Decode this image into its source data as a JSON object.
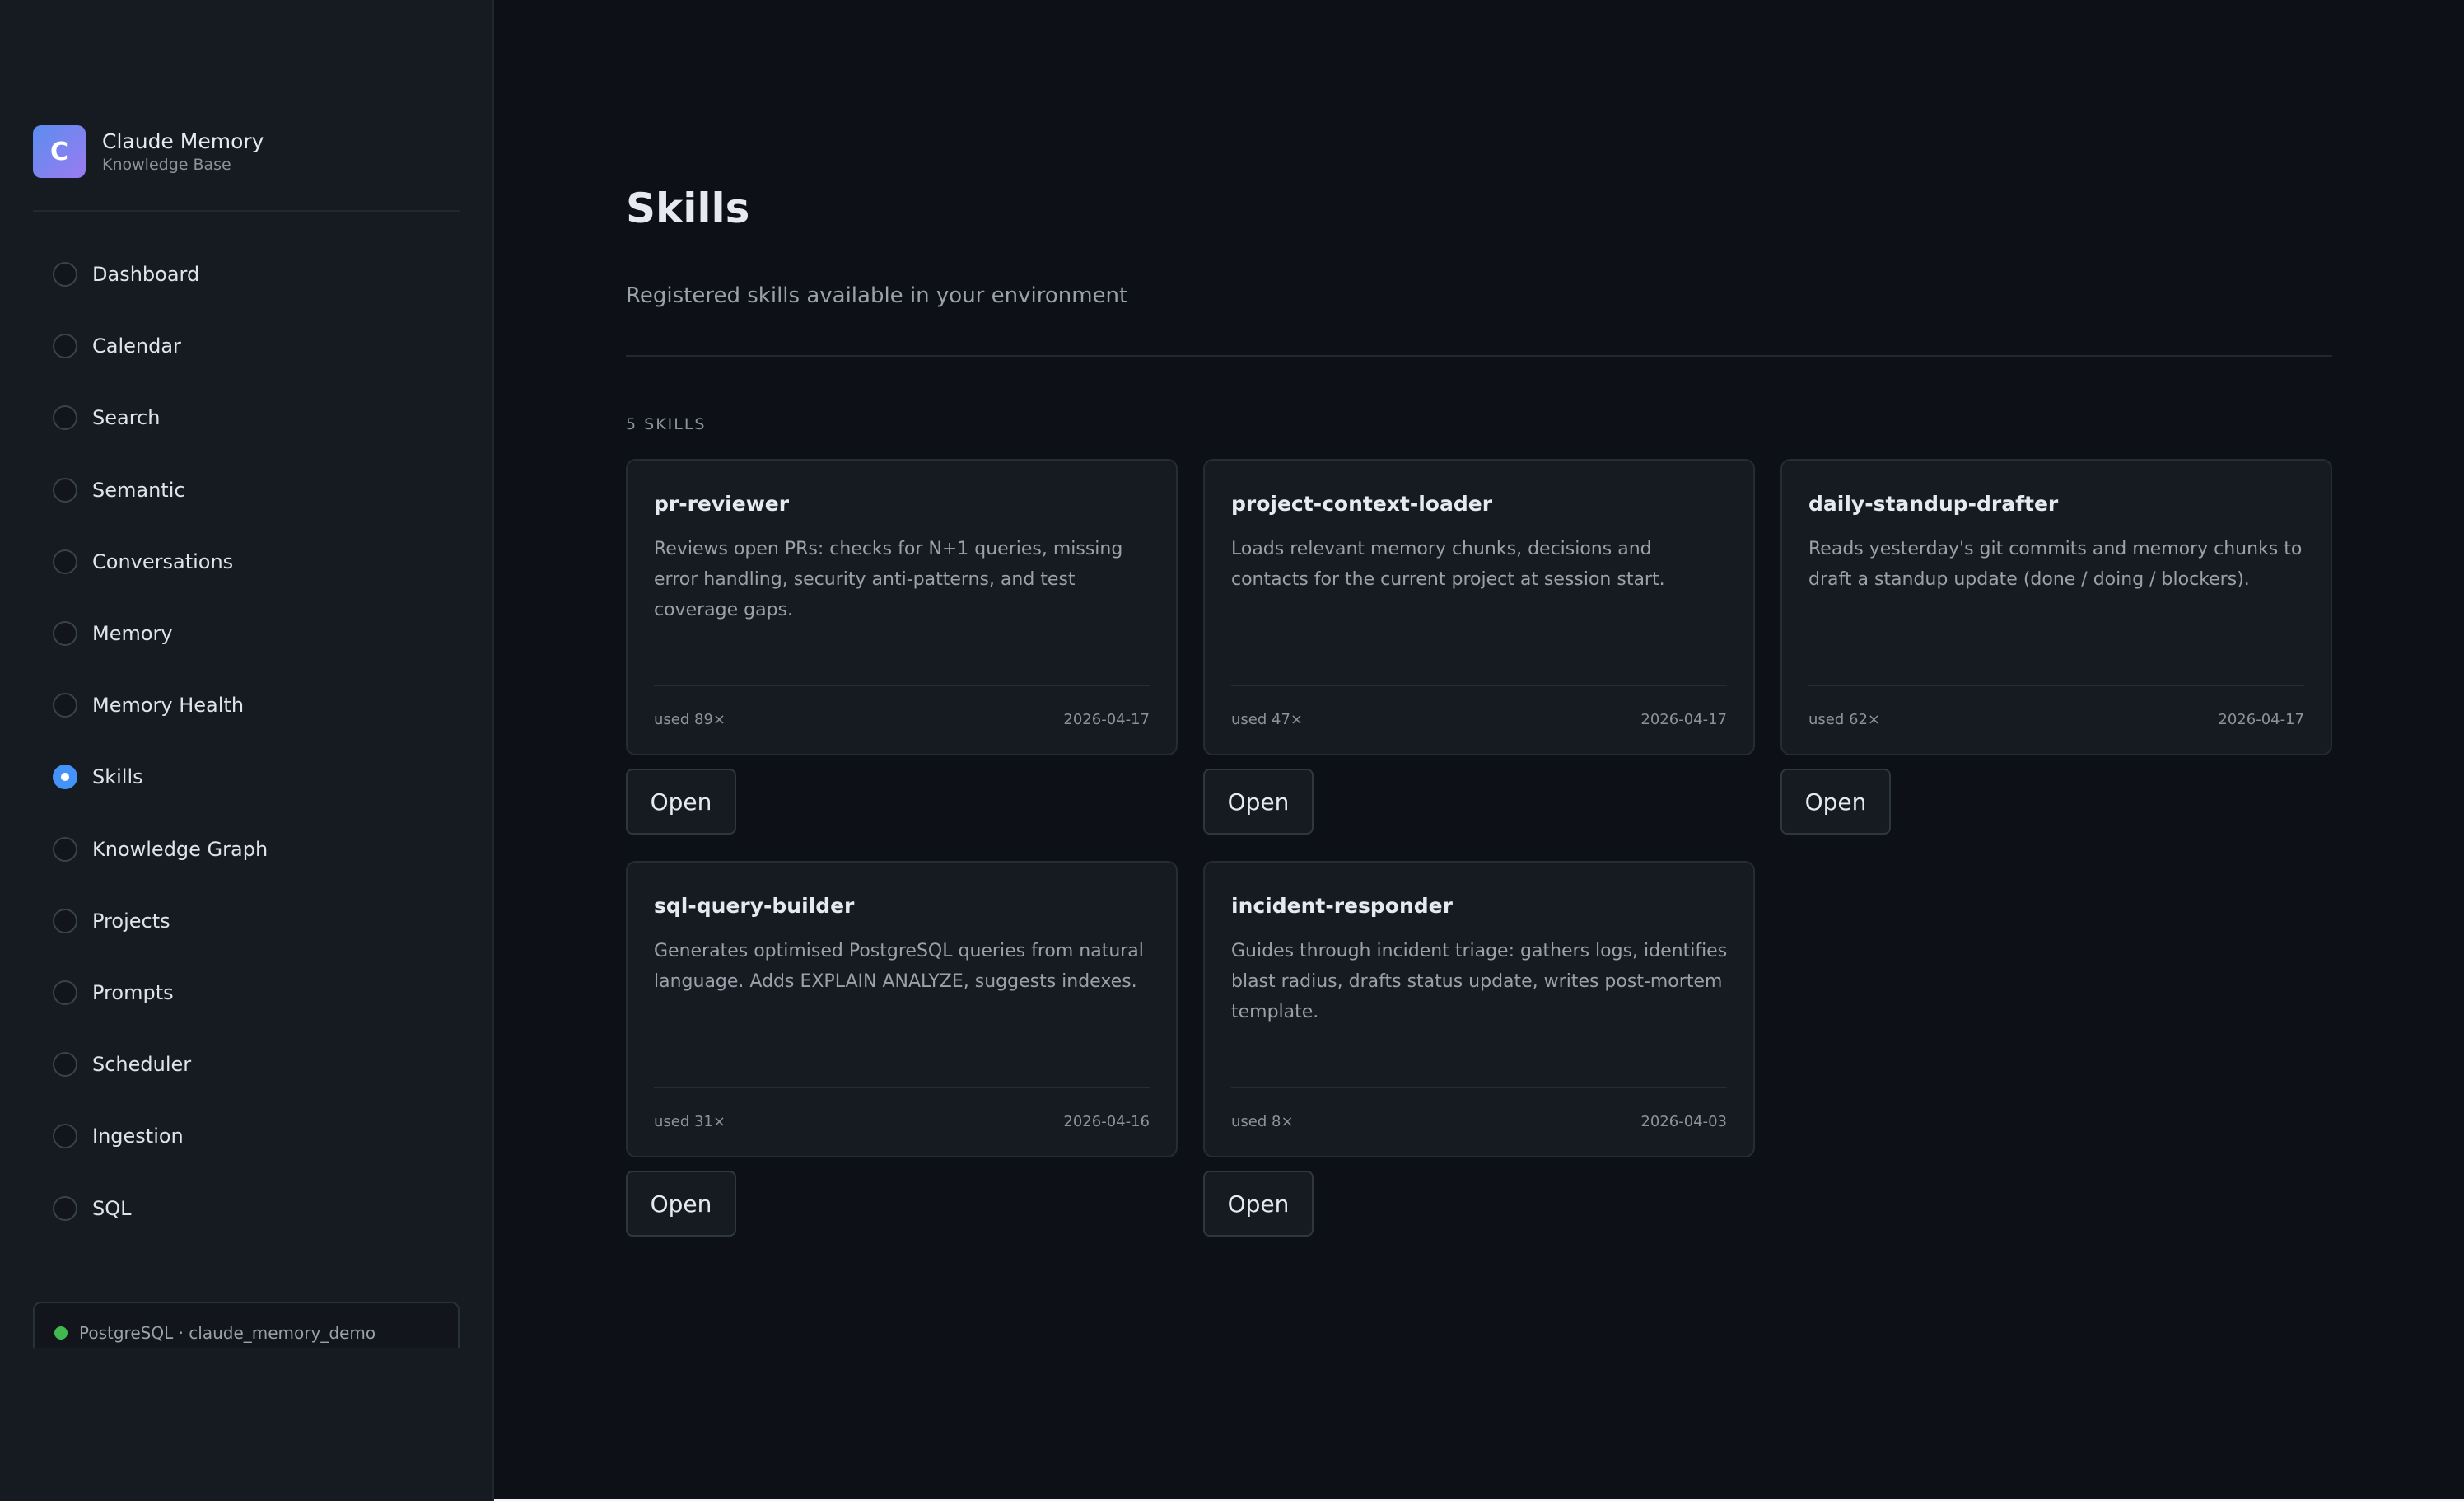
{
  "sidebar": {
    "brand_initial": "C",
    "brand_title": "Claude Memory",
    "brand_subtitle": "Knowledge Base",
    "items": [
      {
        "label": "Dashboard",
        "active": false
      },
      {
        "label": "Calendar",
        "active": false
      },
      {
        "label": "Search",
        "active": false
      },
      {
        "label": "Semantic",
        "active": false
      },
      {
        "label": "Conversations",
        "active": false
      },
      {
        "label": "Memory",
        "active": false
      },
      {
        "label": "Memory Health",
        "active": false
      },
      {
        "label": "Skills",
        "active": true
      },
      {
        "label": "Knowledge Graph",
        "active": false
      },
      {
        "label": "Projects",
        "active": false
      },
      {
        "label": "Prompts",
        "active": false
      },
      {
        "label": "Scheduler",
        "active": false
      },
      {
        "label": "Ingestion",
        "active": false
      },
      {
        "label": "SQL",
        "active": false
      }
    ],
    "db_status": "PostgreSQL · claude_memory_demo",
    "db_status_color": "#3fb950"
  },
  "main": {
    "title": "Skills",
    "subtitle": "Registered skills available in your environment",
    "count_label": "5 SKILLS",
    "skills": [
      {
        "name": "pr-reviewer",
        "description": "Reviews open PRs: checks for N+1 queries, missing error handling, security anti-patterns, and test coverage gaps.",
        "used": "used 89×",
        "date": "2026-04-17",
        "button": "Open"
      },
      {
        "name": "project-context-loader",
        "description": "Loads relevant memory chunks, decisions and contacts for the current project at session start.",
        "used": "used 47×",
        "date": "2026-04-17",
        "button": "Open"
      },
      {
        "name": "daily-standup-drafter",
        "description": "Reads yesterday's git commits and memory chunks to draft a standup update (done / doing / blockers).",
        "used": "used 62×",
        "date": "2026-04-17",
        "button": "Open"
      },
      {
        "name": "sql-query-builder",
        "description": "Generates optimised PostgreSQL queries from natural language. Adds EXPLAIN ANALYZE, suggests indexes.",
        "used": "used 31×",
        "date": "2026-04-16",
        "button": "Open"
      },
      {
        "name": "incident-responder",
        "description": "Guides through incident triage: gathers logs, identifies blast radius, drafts status update, writes post-mortem template.",
        "used": "used 8×",
        "date": "2026-04-03",
        "button": "Open"
      }
    ]
  },
  "colors": {
    "background": "#0d1117",
    "sidebar": "#161b22",
    "accent": "#4493f8",
    "brand_gradient_start": "#5b8def",
    "brand_gradient_end": "#9b7bf0"
  }
}
